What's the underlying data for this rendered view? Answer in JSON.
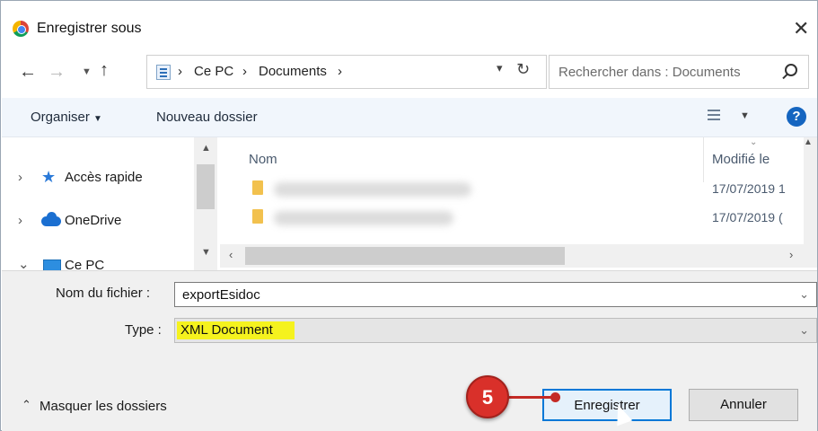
{
  "window": {
    "title": "Enregistrer sous",
    "app_icon": "chrome-icon"
  },
  "address": {
    "breadcrumb": [
      "Ce PC",
      "Documents"
    ],
    "search_placeholder": "Rechercher dans : Documents"
  },
  "toolbar": {
    "organise": "Organiser",
    "new_folder": "Nouveau dossier"
  },
  "nav_pane": {
    "items": [
      {
        "label": "Accès rapide",
        "icon": "star-icon"
      },
      {
        "label": "OneDrive",
        "icon": "cloud-icon"
      },
      {
        "label": "Ce PC",
        "icon": "pc-icon"
      }
    ]
  },
  "file_list": {
    "columns": {
      "name": "Nom",
      "modified": "Modifié le"
    },
    "rows": [
      {
        "name": "",
        "modified": "17/07/2019 1"
      },
      {
        "name": "",
        "modified": "17/07/2019 ("
      }
    ]
  },
  "form": {
    "filename_label": "Nom du fichier :",
    "filename_value": "exportEsidoc",
    "type_label": "Type :",
    "type_value": "XML Document"
  },
  "footer": {
    "hide_folders": "Masquer les dossiers",
    "save_label": "Enregistrer",
    "cancel_label": "Annuler"
  },
  "annotation": {
    "step": "5",
    "color": "#d9302a"
  },
  "colors": {
    "highlight": "#f5f21e",
    "accent": "#0078d7"
  }
}
